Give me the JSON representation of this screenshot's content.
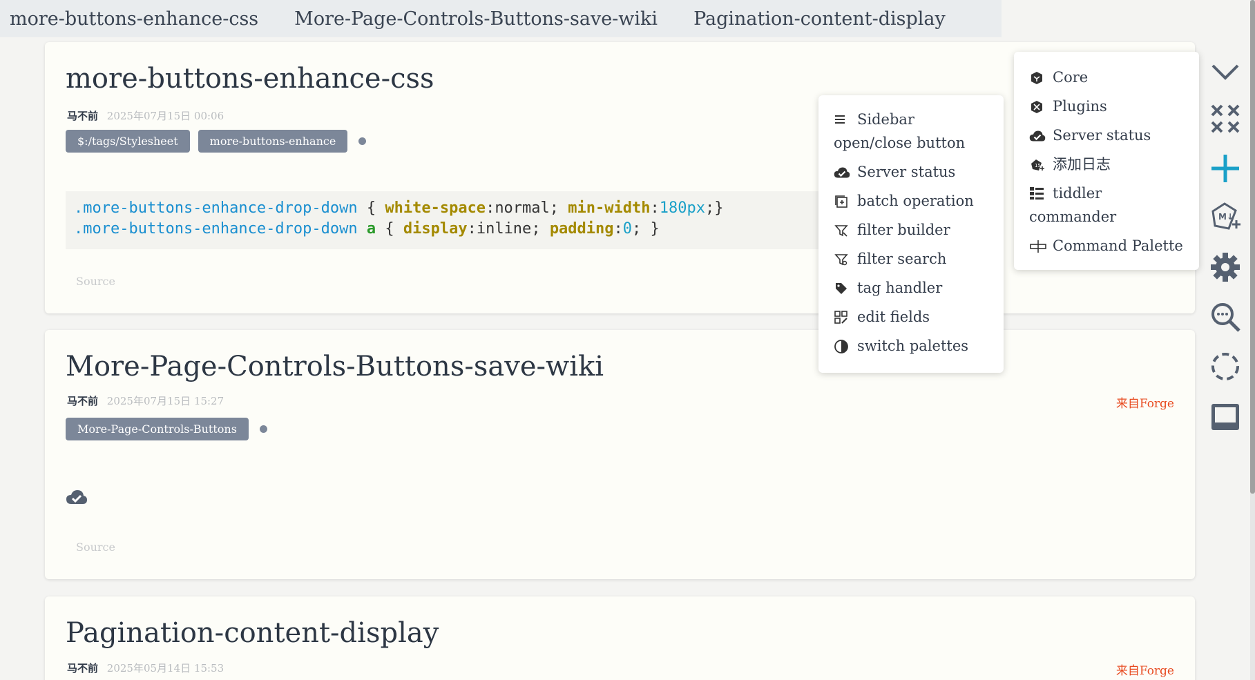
{
  "tabs": [
    "more-buttons-enhance-css",
    "More-Page-Controls-Buttons-save-wiki",
    "Pagination-content-display"
  ],
  "tiddlers": [
    {
      "title": "more-buttons-enhance-css",
      "author": "马不前",
      "date": "2025年07月15日 00:06",
      "tags": [
        "$:/tags/Stylesheet",
        "more-buttons-enhance"
      ],
      "code": {
        "line1": {
          "selector": ".more-buttons-enhance-drop-down",
          "open": " { ",
          "prop1": "white-space",
          "val1": "normal",
          "sep1": "; ",
          "prop2": "min-width",
          "colon": ":",
          "val2": "180px",
          "close": ";}"
        },
        "line2": {
          "selector": ".more-buttons-enhance-drop-down",
          "kw": " a",
          "open": " { ",
          "prop1": "display",
          "val1": "inline",
          "sep1": "; ",
          "prop2": "padding",
          "colon": ":",
          "val2": "0",
          "close": "; }"
        }
      },
      "source": "Source"
    },
    {
      "title": "More-Page-Controls-Buttons-save-wiki",
      "author": "马不前",
      "date": "2025年07月15日 15:27",
      "from": "来自Forge",
      "tags": [
        "More-Page-Controls-Buttons"
      ],
      "source": "Source"
    },
    {
      "title": "Pagination-content-display",
      "author": "马不前",
      "date": "2025年05月14日 15:53",
      "from": "来自Forge"
    }
  ],
  "popup_left": {
    "items": [
      {
        "label_line1": "Sidebar",
        "label_line2": "open/close button",
        "icon": "hamburger-icon"
      },
      {
        "label": "Server status",
        "icon": "cloud-check-icon"
      },
      {
        "label": "batch operation",
        "icon": "batch-icon"
      },
      {
        "label": "filter builder",
        "icon": "filter-icon"
      },
      {
        "label": "filter search",
        "icon": "filter-search-icon"
      },
      {
        "label": "tag handler",
        "icon": "tag-icon"
      },
      {
        "label": "edit fields",
        "icon": "edit-fields-icon"
      },
      {
        "label": "switch palettes",
        "icon": "palette-icon"
      }
    ]
  },
  "popup_right": {
    "items": [
      {
        "label": "Core",
        "icon": "core-icon"
      },
      {
        "label": "Plugins",
        "icon": "plugin-icon"
      },
      {
        "label": "Server status",
        "icon": "cloud-check-icon"
      },
      {
        "label": "添加日志",
        "icon": "journal-icon"
      },
      {
        "label_line1": "tiddler",
        "label_line2": "commander",
        "icon": "commander-icon"
      },
      {
        "label": "Command Palette",
        "icon": "command-palette-icon"
      }
    ]
  },
  "colors": {
    "accent": "#1aa0c8",
    "tag_bg": "#7c8799",
    "from_text": "#e84a1f",
    "icon": "#556070"
  }
}
